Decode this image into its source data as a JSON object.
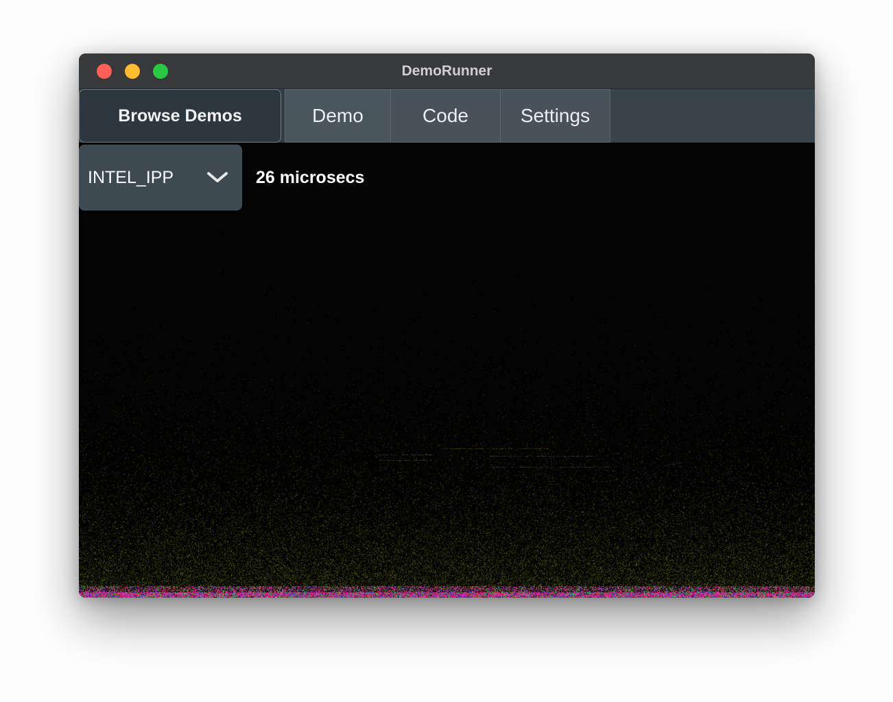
{
  "window": {
    "title": "DemoRunner",
    "traffic_lights": {
      "close_color": "#ff5f57",
      "minimize_color": "#febc2e",
      "zoom_color": "#28c840"
    }
  },
  "tabs": {
    "browse_label": "Browse Demos",
    "items": [
      {
        "label": "Demo"
      },
      {
        "label": "Code"
      },
      {
        "label": "Settings"
      }
    ]
  },
  "toolbar": {
    "engine_selector": {
      "value": "INTEL_IPP",
      "icon": "chevron-down-icon"
    },
    "timing_label": "26 microsecs"
  },
  "visualization": {
    "kind": "fft-spectrogram",
    "background_color": "#030303",
    "noise_colors": [
      "#ff2044",
      "#e020c0",
      "#20c040",
      "#2080ff"
    ]
  }
}
